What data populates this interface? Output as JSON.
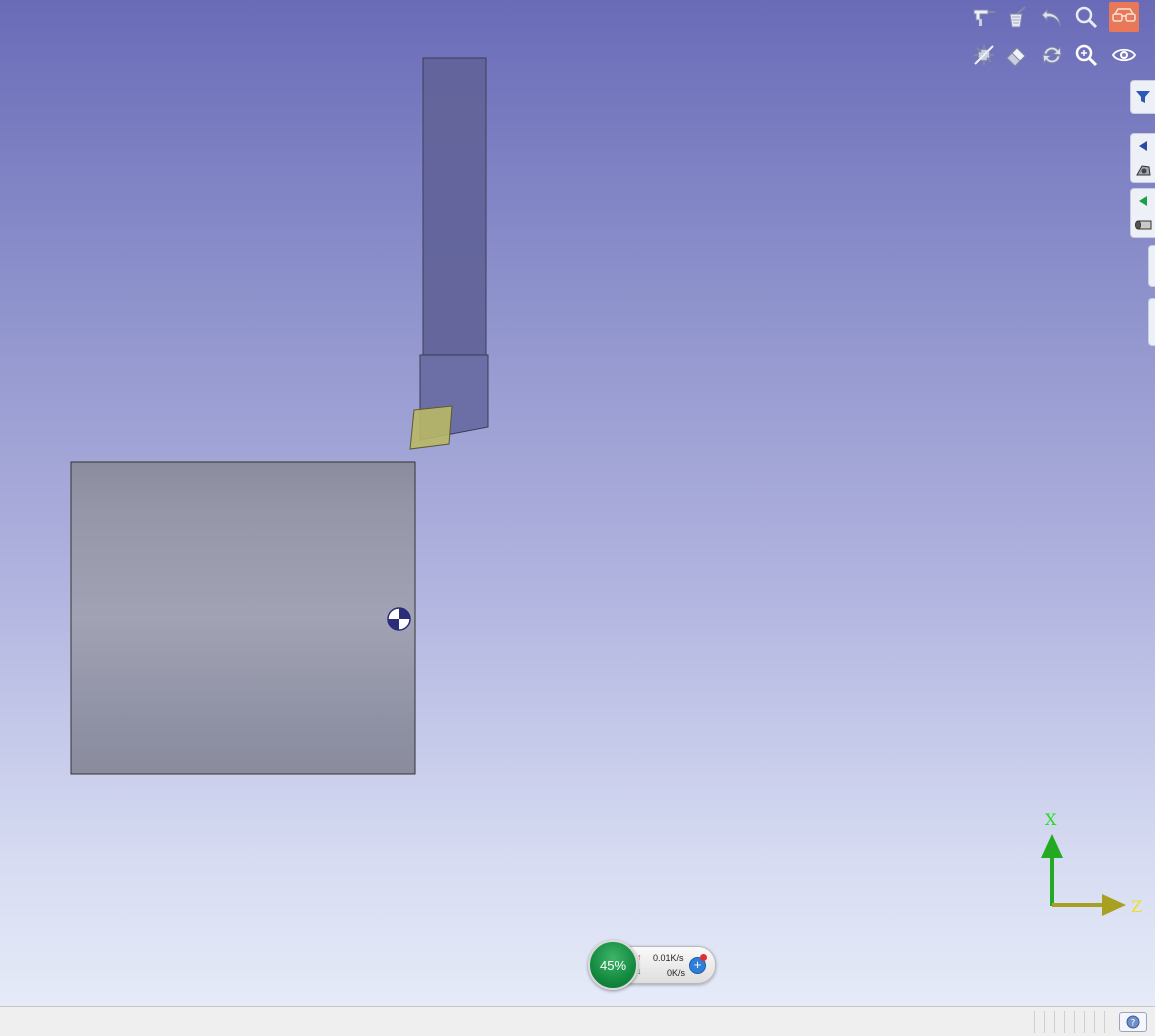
{
  "toolbar": {
    "row1": [
      "measure-icon",
      "clear-icon",
      "undo-icon",
      "zoom-icon",
      "glasses-icon"
    ],
    "row2": [
      "hide-parts-icon",
      "eraser-icon",
      "rotate-icon",
      "zoom-fit-icon",
      "view-eye-icon"
    ],
    "active": "glasses-icon"
  },
  "side_tabs": [
    "filter-icon",
    "collapse-arrow-icon",
    "tool-holder-icon",
    "expand-arrow-icon",
    "stock-cylinder-icon"
  ],
  "scene": {
    "tool_color": "#6466a0",
    "insert_color": "#b8b860",
    "stock_color": "#9598ad"
  },
  "axes": {
    "x_label": "X",
    "z_label": "Z",
    "x_color": "#22aa22",
    "z_color": "#b0a020"
  },
  "network": {
    "percent": "45%",
    "upload": "0.01K/s",
    "download": "0K/s"
  },
  "statusbar": {
    "text": ""
  }
}
